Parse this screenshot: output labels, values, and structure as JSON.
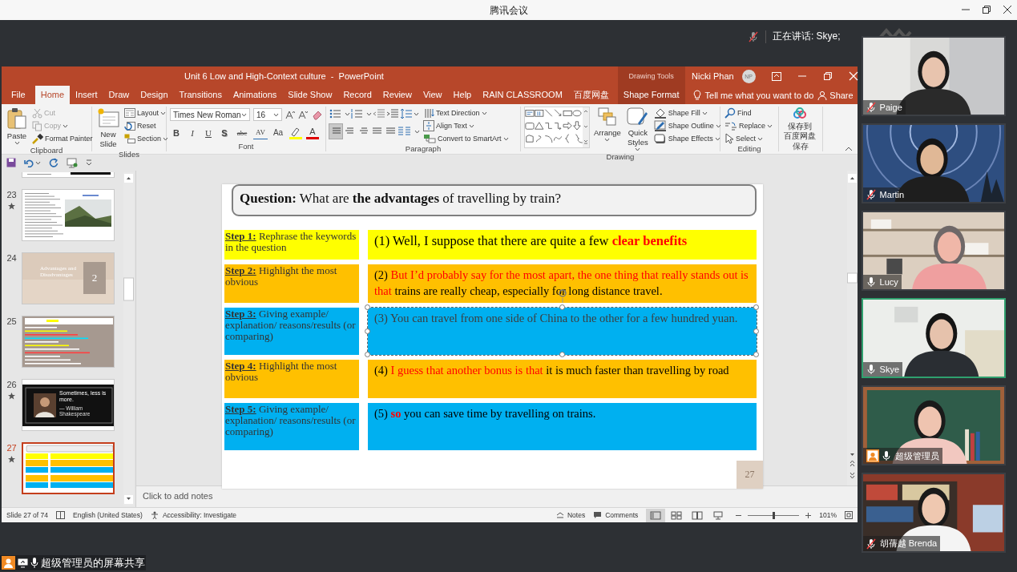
{
  "meeting": {
    "title": "腾讯会议",
    "speaking": "正在讲话: Skye;"
  },
  "powerpoint": {
    "title": "Unit 6 Low and High-Context culture  -  PowerPoint",
    "context_group": "Drawing Tools",
    "user": {
      "name": "Nicki Phan",
      "initials": "NP"
    },
    "tabs": [
      {
        "label": "File",
        "selected": false,
        "kind": "normal"
      },
      {
        "label": "Home",
        "selected": true,
        "kind": "normal"
      },
      {
        "label": "Insert",
        "selected": false,
        "kind": "normal"
      },
      {
        "label": "Draw",
        "selected": false,
        "kind": "normal"
      },
      {
        "label": "Design",
        "selected": false,
        "kind": "normal"
      },
      {
        "label": "Transitions",
        "selected": false,
        "kind": "normal"
      },
      {
        "label": "Animations",
        "selected": false,
        "kind": "normal"
      },
      {
        "label": "Slide Show",
        "selected": false,
        "kind": "normal"
      },
      {
        "label": "Record",
        "selected": false,
        "kind": "normal"
      },
      {
        "label": "Review",
        "selected": false,
        "kind": "normal"
      },
      {
        "label": "View",
        "selected": false,
        "kind": "normal"
      },
      {
        "label": "Help",
        "selected": false,
        "kind": "normal"
      },
      {
        "label": "RAIN CLASSROOM",
        "selected": false,
        "kind": "normal"
      },
      {
        "label": "百度网盘",
        "selected": false,
        "kind": "normal"
      },
      {
        "label": "Shape Format",
        "selected": false,
        "kind": "contextual"
      }
    ],
    "tell_me": {
      "placeholder": "Tell me what you want to do"
    },
    "share": "Share",
    "ribbon": {
      "groups": [
        {
          "label": "Clipboard",
          "kind": "clipboard",
          "large": [
            "Paste"
          ],
          "items": [
            {
              "label": "Cut",
              "disabled": true
            },
            {
              "label": "Copy",
              "disabled": true
            },
            {
              "label": "Format Painter",
              "disabled": false
            }
          ]
        },
        {
          "label": "Slides",
          "kind": "slides",
          "large": [
            "New Slide"
          ],
          "items": [
            {
              "label": "Layout"
            },
            {
              "label": "Reset"
            },
            {
              "label": "Section"
            }
          ]
        },
        {
          "label": "Font",
          "kind": "font",
          "font_name": "Times New Roman",
          "font_size": "16",
          "buttons": [
            {
              "label": "B",
              "kind": "bold"
            },
            {
              "label": "I",
              "kind": "italic"
            },
            {
              "label": "U",
              "kind": "underline"
            },
            {
              "label": "S",
              "kind": "shadow"
            },
            {
              "label": "abc",
              "kind": "strike"
            },
            {
              "label": "AV",
              "kind": "spacing"
            },
            {
              "label": "Aa",
              "kind": "case"
            },
            {
              "label": "A",
              "kind": "color"
            }
          ]
        },
        {
          "label": "Paragraph",
          "kind": "paragraph",
          "align_buttons": [
            {
              "selected": true
            },
            {
              "selected": false
            },
            {
              "selected": false
            },
            {
              "selected": false
            },
            {
              "selected": false
            }
          ],
          "items": [
            {
              "label": "Text Direction"
            },
            {
              "label": "Align Text"
            },
            {
              "label": "Convert to SmartArt"
            }
          ]
        },
        {
          "label": "Drawing",
          "kind": "drawing",
          "large": [
            "Arrange",
            "Quick Styles"
          ],
          "items": [
            {
              "label": "Shape Fill"
            },
            {
              "label": "Shape Outline"
            },
            {
              "label": "Shape Effects"
            }
          ]
        },
        {
          "label": "Editing",
          "kind": "editing",
          "items": [
            {
              "label": "Find"
            },
            {
              "label": "Replace"
            },
            {
              "label": "Select"
            }
          ]
        },
        {
          "label": "保存",
          "kind": "save",
          "lines": [
            "保存到",
            "百度网盘"
          ]
        }
      ]
    },
    "thumbnails": [
      {
        "kind": "cut-off",
        "animated": false,
        "selected": false
      },
      {
        "number": "23",
        "kind": "text-photo",
        "animated": true,
        "selected": false
      },
      {
        "number": "24",
        "kind": "title",
        "title": "Advantages and Disadvantages",
        "badge": "2",
        "animated": false,
        "selected": false
      },
      {
        "number": "25",
        "kind": "text-lines",
        "animated": false,
        "selected": false
      },
      {
        "number": "26",
        "kind": "quote",
        "quote": "Sometimes, less is more.",
        "author": "— William Shakespeare",
        "animated": true,
        "selected": false
      },
      {
        "number": "27",
        "kind": "table",
        "animated": true,
        "selected": true
      }
    ],
    "slide": {
      "question": "**Question:** What are **the advantages** of travelling by train?",
      "rows": [
        {
          "step": "**Step 1:** Rephrase the keywords in the question",
          "color": "#ffff00",
          "selected": false,
          "answer": [
            {
              "text": "(1) Well, I suppose that there are quite a few ",
              "kind": "plain"
            },
            {
              "text": "clear benefits",
              "kind": "emphasis"
            }
          ]
        },
        {
          "step": "**Step 2:** Highlight the most obvious",
          "color": "#ffc000",
          "selected": false,
          "answer": [
            {
              "text": "(2) ",
              "kind": "plain"
            },
            {
              "text": "But I’d probably say for the most apart, the one thing that really stands out is that",
              "kind": "phrase"
            },
            {
              "text": " trains are really cheap, especially for long distance travel.",
              "kind": "plain"
            }
          ]
        },
        {
          "step": "**Step 3:** Giving example/ explanation/ reasons/results (or comparing)",
          "color": "#00b0f0",
          "selected": true,
          "answer": [
            {
              "text": "(3) You can travel from one side of China to the other for a few hundred yuan.",
              "kind": "muted"
            }
          ]
        },
        {
          "step": "**Step 4:** Highlight the most obvious",
          "color": "#ffc000",
          "selected": false,
          "answer": [
            {
              "text": "(4) ",
              "kind": "plain"
            },
            {
              "text": "I guess that another bonus is that",
              "kind": "phrase"
            },
            {
              "text": " it is much faster than travelling by road",
              "kind": "plain"
            }
          ]
        },
        {
          "step": "**Step 5:** Giving example/ explanation/ reasons/results (or comparing)",
          "color": "#00b0f0",
          "selected": false,
          "answer": [
            {
              "text": "(5) ",
              "kind": "plain"
            },
            {
              "text": "so",
              "kind": "emphasis"
            },
            {
              "text": " you can save time by travelling on trains.",
              "kind": "plain"
            }
          ]
        }
      ],
      "page_number": "27"
    },
    "notes": {
      "placeholder": "Click to add notes"
    },
    "status": {
      "slide": "Slide 27 of 74",
      "language": "English (United States)",
      "accessibility": "Accessibility: Investigate",
      "notes": "Notes",
      "comments": "Comments",
      "views": [
        {
          "selected": true
        },
        {
          "selected": false
        },
        {
          "selected": false
        },
        {
          "selected": false
        }
      ],
      "zoom": {
        "level": 0.5,
        "reading": "101%"
      }
    }
  },
  "participants": [
    {
      "name": "Paige",
      "muted": true,
      "speaking": false,
      "host": false,
      "kind": "picture"
    },
    {
      "name": "Martin",
      "muted": true,
      "speaking": false,
      "host": false,
      "kind": "picture"
    },
    {
      "name": "Lucy",
      "muted": false,
      "speaking": false,
      "host": false,
      "kind": "picture"
    },
    {
      "name": "Skye",
      "muted": false,
      "speaking": true,
      "host": false,
      "kind": "picture"
    },
    {
      "name": "超级管理员",
      "muted": false,
      "speaking": false,
      "host": true,
      "kind": "picture"
    },
    {
      "name": "胡蒨越 Brenda",
      "muted": true,
      "speaking": false,
      "host": false,
      "kind": "picture"
    }
  ],
  "share_label": "超级管理员的屏幕共享"
}
